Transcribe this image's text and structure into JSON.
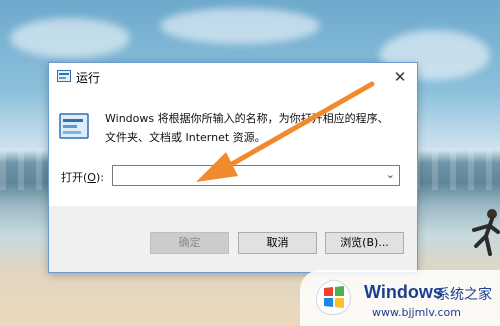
{
  "dialog": {
    "title": "运行",
    "close_glyph": "✕",
    "description": "Windows 将根据你所输入的名称，为你打开相应的程序、\n文件夹、文档或 Internet 资源。",
    "open_label_prefix": "打开(",
    "open_label_key": "O",
    "open_label_suffix": "):",
    "input_value": "",
    "dropdown_glyph": "⌄",
    "buttons": {
      "ok": "确定",
      "cancel": "取消",
      "browse": "浏览(B)..."
    }
  },
  "watermark": {
    "brand": "Windows",
    "cn": "系统之家",
    "url": "www.bjjmlv.com"
  },
  "colors": {
    "accent_arrow": "#f08a2c",
    "dialog_border": "#6a9bd1",
    "brand_blue": "#1c3f8f"
  },
  "icons": {
    "title": "run-icon",
    "content": "run-large-icon",
    "logo": "windows-logo"
  }
}
